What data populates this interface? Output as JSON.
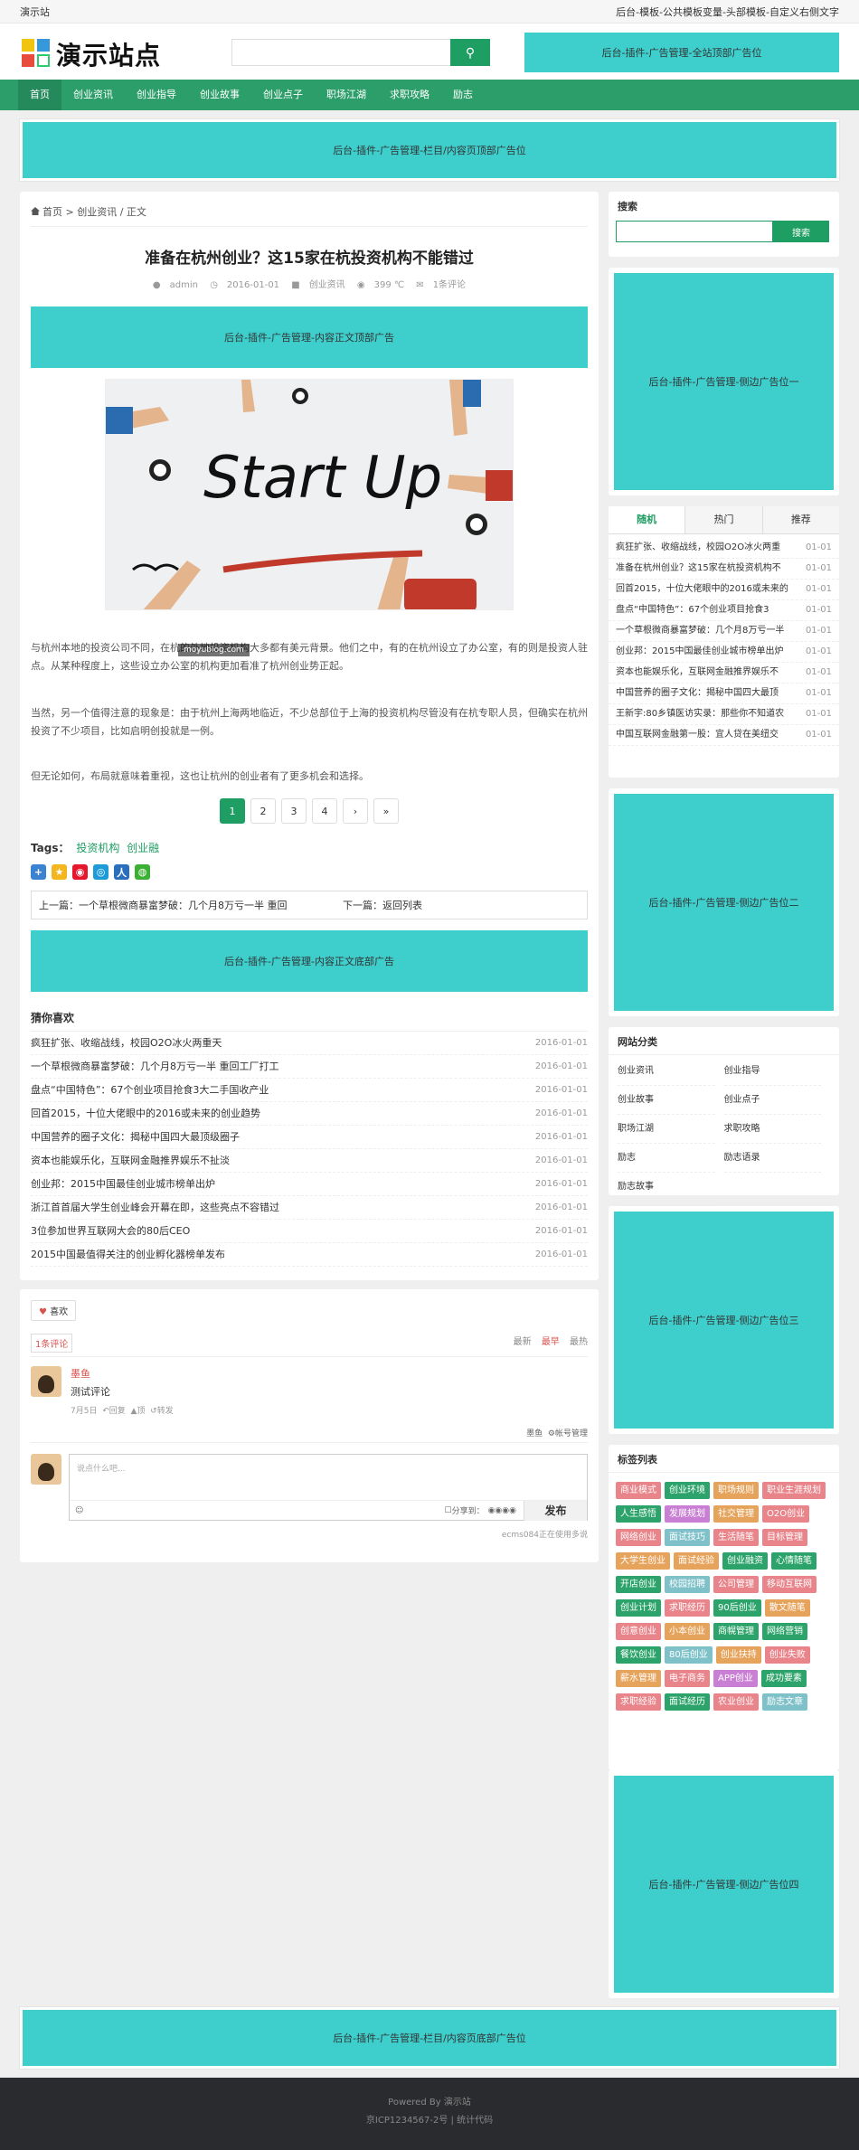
{
  "topbar": {
    "site": "演示站",
    "right": "后台-模板-公共模板变量-头部模板-自定义右侧文字"
  },
  "header": {
    "logo": "演示站点",
    "search_placeholder": "",
    "ad": "后台-插件-广告管理-全站顶部广告位"
  },
  "nav": [
    "首页",
    "创业资讯",
    "创业指导",
    "创业故事",
    "创业点子",
    "职场江湖",
    "求职攻略",
    "励志"
  ],
  "ad_list_top": "后台-插件-广告管理-栏目/内容页顶部广告位",
  "breadcrumb": {
    "home": "首页",
    "sep": ">",
    "cat": "创业资讯",
    "tail": "/ 正文"
  },
  "article": {
    "title": "准备在杭州创业？这15家在杭投资机构不能错过",
    "author": "admin",
    "date": "2016-01-01",
    "category": "创业资讯",
    "views": "399 ℃",
    "comments": "1条评论",
    "ad_top": "后台-插件-广告管理-内容正文顶部广告",
    "p1": "与杭州本地的投资公司不同，在杭的外地投资机构大多都有美元背景。他们之中，有的在杭州设立了办公室，有的则是投资人驻点。从某种程度上，这些设立办公室的机构更加看准了杭州创业势正起。",
    "p2": "当然，另一个值得注意的现象是：由于杭州上海两地临近，不少总部位于上海的投资机构尽管没有在杭专职人员，但确实在杭州投资了不少项目，比如启明创投就是一例。",
    "p3": "但无论如何，布局就意味着重视，这也让杭州的创业者有了更多机会和选择。",
    "hero_text": "Start Up",
    "watermark": "moyublog.com"
  },
  "pager": [
    "1",
    "2",
    "3",
    "4",
    "›",
    "»"
  ],
  "tags": {
    "label": "Tags：",
    "items": [
      "投资机构",
      "创业融"
    ]
  },
  "prevnext": {
    "prev": "上一篇：一个草根微商暴富梦破：几个月8万亏一半 重回",
    "next": "下一篇：返回列表"
  },
  "ad_article_bottom": "后台-插件-广告管理-内容正文底部广告",
  "guess": {
    "title": "猜你喜欢",
    "items": [
      {
        "t": "疯狂扩张、收缩战线，校园O2O冰火两重天",
        "d": "2016-01-01"
      },
      {
        "t": "一个草根微商暴富梦破：几个月8万亏一半 重回工厂打工",
        "d": "2016-01-01"
      },
      {
        "t": "盘点“中国特色”：67个创业项目抢食3大二手国收产业",
        "d": "2016-01-01"
      },
      {
        "t": "回首2015，十位大佬眼中的2016或未来的创业趋势",
        "d": "2016-01-01"
      },
      {
        "t": "中国营养的圈子文化：揭秘中国四大最顶级圈子",
        "d": "2016-01-01"
      },
      {
        "t": "资本也能娱乐化，互联网金融推界娱乐不扯淡",
        "d": "2016-01-01"
      },
      {
        "t": "创业邦：2015中国最佳创业城市榜单出炉",
        "d": "2016-01-01"
      },
      {
        "t": "浙江首首届大学生创业峰会开幕在即，这些亮点不容错过",
        "d": "2016-01-01"
      },
      {
        "t": "3位参加世界互联网大会的80后CEO",
        "d": "2016-01-01"
      },
      {
        "t": "2015中国最值得关注的创业孵化器榜单发布",
        "d": "2016-01-01"
      }
    ]
  },
  "comment": {
    "like": "喜欢",
    "count": "1条评论",
    "sort": [
      "最新",
      "最早",
      "最热"
    ],
    "user": "墨鱼",
    "text": "测试评论",
    "time": "7月5日",
    "reply": "回复",
    "up": "顶",
    "forward": "转发",
    "manage_user": "墨鱼",
    "manage": "帐号管理",
    "placeholder": "说点什么吧...",
    "share": "分享到：",
    "publish": "发布",
    "powered": "ecms084正在使用多说"
  },
  "sidebar": {
    "search_title": "搜索",
    "search_btn": "搜索",
    "ad1": "后台-插件-广告管理-侧边广告位一",
    "tabs": [
      "随机",
      "热门",
      "推荐"
    ],
    "random": [
      {
        "t": "疯狂扩张、收缩战线，校园O2O冰火两重",
        "d": "01-01"
      },
      {
        "t": "准备在杭州创业？这15家在杭投资机构不",
        "d": "01-01"
      },
      {
        "t": "回首2015，十位大佬眼中的2016或未来的",
        "d": "01-01"
      },
      {
        "t": "盘点“中国特色”：67个创业项目抢食3",
        "d": "01-01"
      },
      {
        "t": "一个草根微商暴富梦破：几个月8万亏一半",
        "d": "01-01"
      },
      {
        "t": "创业邦：2015中国最佳创业城市榜单出炉",
        "d": "01-01"
      },
      {
        "t": "资本也能娱乐化，互联网金融推界娱乐不",
        "d": "01-01"
      },
      {
        "t": "中国营养的圈子文化：揭秘中国四大最顶",
        "d": "01-01"
      },
      {
        "t": "王新宇:80乡镇医访实录：那些你不知道农",
        "d": "01-01"
      },
      {
        "t": "中国互联网金融第一股：宜人贷在美纽交",
        "d": "01-01"
      }
    ],
    "ad2": "后台-插件-广告管理-侧边广告位二",
    "cat_title": "网站分类",
    "cats": [
      "创业资讯",
      "创业指导",
      "创业故事",
      "创业点子",
      "职场江湖",
      "求职攻略",
      "励志",
      "励志语录",
      "励志故事"
    ],
    "ad3": "后台-插件-广告管理-侧边广告位三",
    "tag_title": "标签列表",
    "tags": [
      {
        "t": "商业模式",
        "c": "#e8848a"
      },
      {
        "t": "创业环境",
        "c": "#2ca36a"
      },
      {
        "t": "职场规则",
        "c": "#e6a35c"
      },
      {
        "t": "职业生涯规划",
        "c": "#e8848a"
      },
      {
        "t": "人生感悟",
        "c": "#2ca36a"
      },
      {
        "t": "发展规划",
        "c": "#c97fd4"
      },
      {
        "t": "社交管理",
        "c": "#e6a35c"
      },
      {
        "t": "O2O创业",
        "c": "#e8848a"
      },
      {
        "t": "网络创业",
        "c": "#e8848a"
      },
      {
        "t": "面试技巧",
        "c": "#7fc1c9"
      },
      {
        "t": "生活随笔",
        "c": "#e8848a"
      },
      {
        "t": "目标管理",
        "c": "#e8848a"
      },
      {
        "t": "大学生创业",
        "c": "#e6a35c"
      },
      {
        "t": "面试经验",
        "c": "#e6a35c"
      },
      {
        "t": "创业融资",
        "c": "#2ca36a"
      },
      {
        "t": "心情随笔",
        "c": "#2ca36a"
      },
      {
        "t": "开店创业",
        "c": "#2ca36a"
      },
      {
        "t": "校园招聘",
        "c": "#7fc1c9"
      },
      {
        "t": "公司管理",
        "c": "#e8848a"
      },
      {
        "t": "移动互联网",
        "c": "#e8848a"
      },
      {
        "t": "创业计划",
        "c": "#2ca36a"
      },
      {
        "t": "求职经历",
        "c": "#e8848a"
      },
      {
        "t": "90后创业",
        "c": "#2ca36a"
      },
      {
        "t": "散文随笔",
        "c": "#e6a35c"
      },
      {
        "t": "创意创业",
        "c": "#e8848a"
      },
      {
        "t": "小本创业",
        "c": "#e6a35c"
      },
      {
        "t": "商幌管理",
        "c": "#2ca36a"
      },
      {
        "t": "网络营销",
        "c": "#2ca36a"
      },
      {
        "t": "餐饮创业",
        "c": "#2ca36a"
      },
      {
        "t": "80后创业",
        "c": "#7fc1c9"
      },
      {
        "t": "创业扶持",
        "c": "#e6a35c"
      },
      {
        "t": "创业失败",
        "c": "#e8848a"
      },
      {
        "t": "薪水管理",
        "c": "#e6a35c"
      },
      {
        "t": "电子商务",
        "c": "#e8848a"
      },
      {
        "t": "APP创业",
        "c": "#c97fd4"
      },
      {
        "t": "成功要素",
        "c": "#2ca36a"
      },
      {
        "t": "求职经验",
        "c": "#e8848a"
      },
      {
        "t": "面试经历",
        "c": "#2ca36a"
      },
      {
        "t": "农业创业",
        "c": "#e8848a"
      },
      {
        "t": "励志文章",
        "c": "#7fc1c9"
      }
    ],
    "ad4": "后台-插件-广告管理-侧边广告位四"
  },
  "ad_list_bottom": "后台-插件-广告管理-栏目/内容页底部广告位",
  "footer": {
    "powered": "Powered By 演示站",
    "icp": "京ICP1234567-2号 | 统计代码"
  }
}
